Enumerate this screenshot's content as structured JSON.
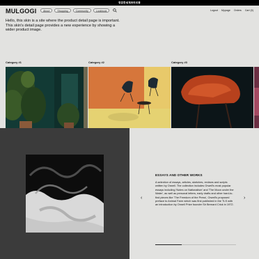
{
  "topbar": {
    "text": "영원한세계와의리뷰"
  },
  "header": {
    "logo": "MULGOGI",
    "nav": [
      "About",
      "Shopping",
      "Community",
      "Lookbook"
    ],
    "right_nav": [
      "Logout",
      "Mypage",
      "Orders",
      "Cart (0)"
    ]
  },
  "intro": {
    "text": "Hello, this skin is a site where the product detail page is important. This skin's detail page provides a new experience by showing a wider product image."
  },
  "categories": [
    {
      "label": "Category #1"
    },
    {
      "label": "Category #2"
    },
    {
      "label": "Category #3"
    }
  ],
  "feature": {
    "title": "ESSAYS AND OTHER WORKS",
    "body": "A selection of essays, articles, sketches, reviews and scripts written by Orwell. The collection includes Orwell's most popular essays including 'Notes on Nationalism' and 'The Moon under the Water', as well as personal letters, early drafts and other hard-to-find pieces like 'The Freedom of the Press', Orwell's proposed preface to Animal Farm which was first published in the TLS with an introduction by Orwell Prize founder Sir Bernard Crick in 1972.",
    "prev_label": "‹",
    "next_label": "›",
    "progress": 0.33
  },
  "colors": {
    "accent": "#111111",
    "background": "#e2e2e0",
    "dark_panel": "#3b3b3b"
  }
}
